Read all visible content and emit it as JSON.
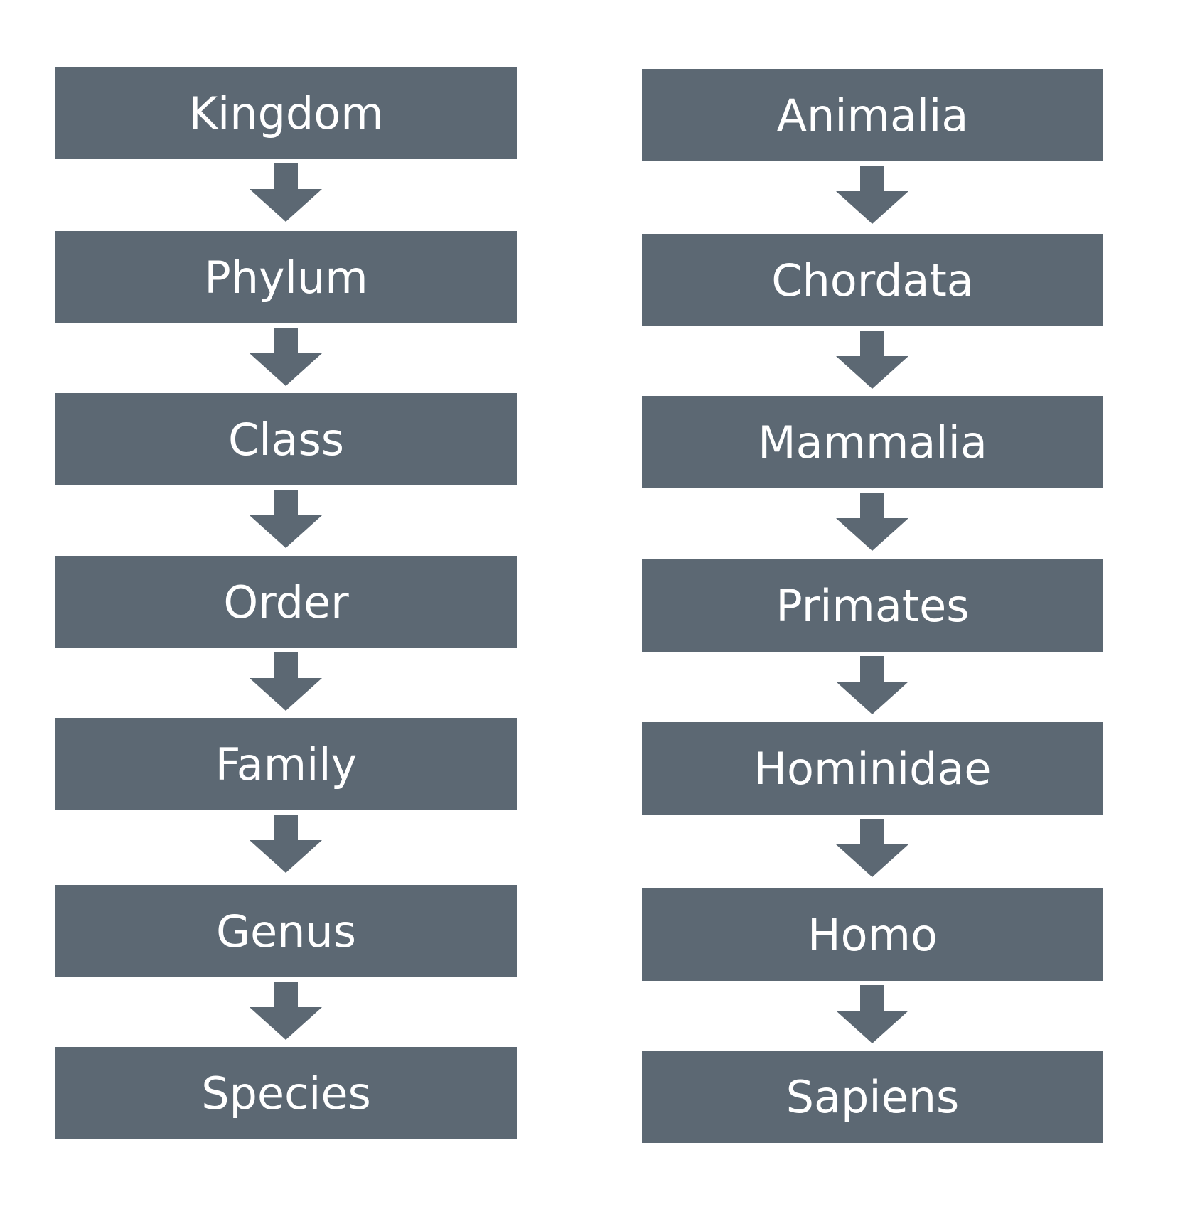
{
  "colors": {
    "box": "#5c6873",
    "text": "#ffffff",
    "arrow": "#5c6873"
  },
  "ranks": [
    "Kingdom",
    "Phylum",
    "Class",
    "Order",
    "Family",
    "Genus",
    "Species"
  ],
  "human": [
    "Animalia",
    "Chordata",
    "Mammalia",
    "Primates",
    "Hominidae",
    "Homo",
    "Sapiens"
  ]
}
